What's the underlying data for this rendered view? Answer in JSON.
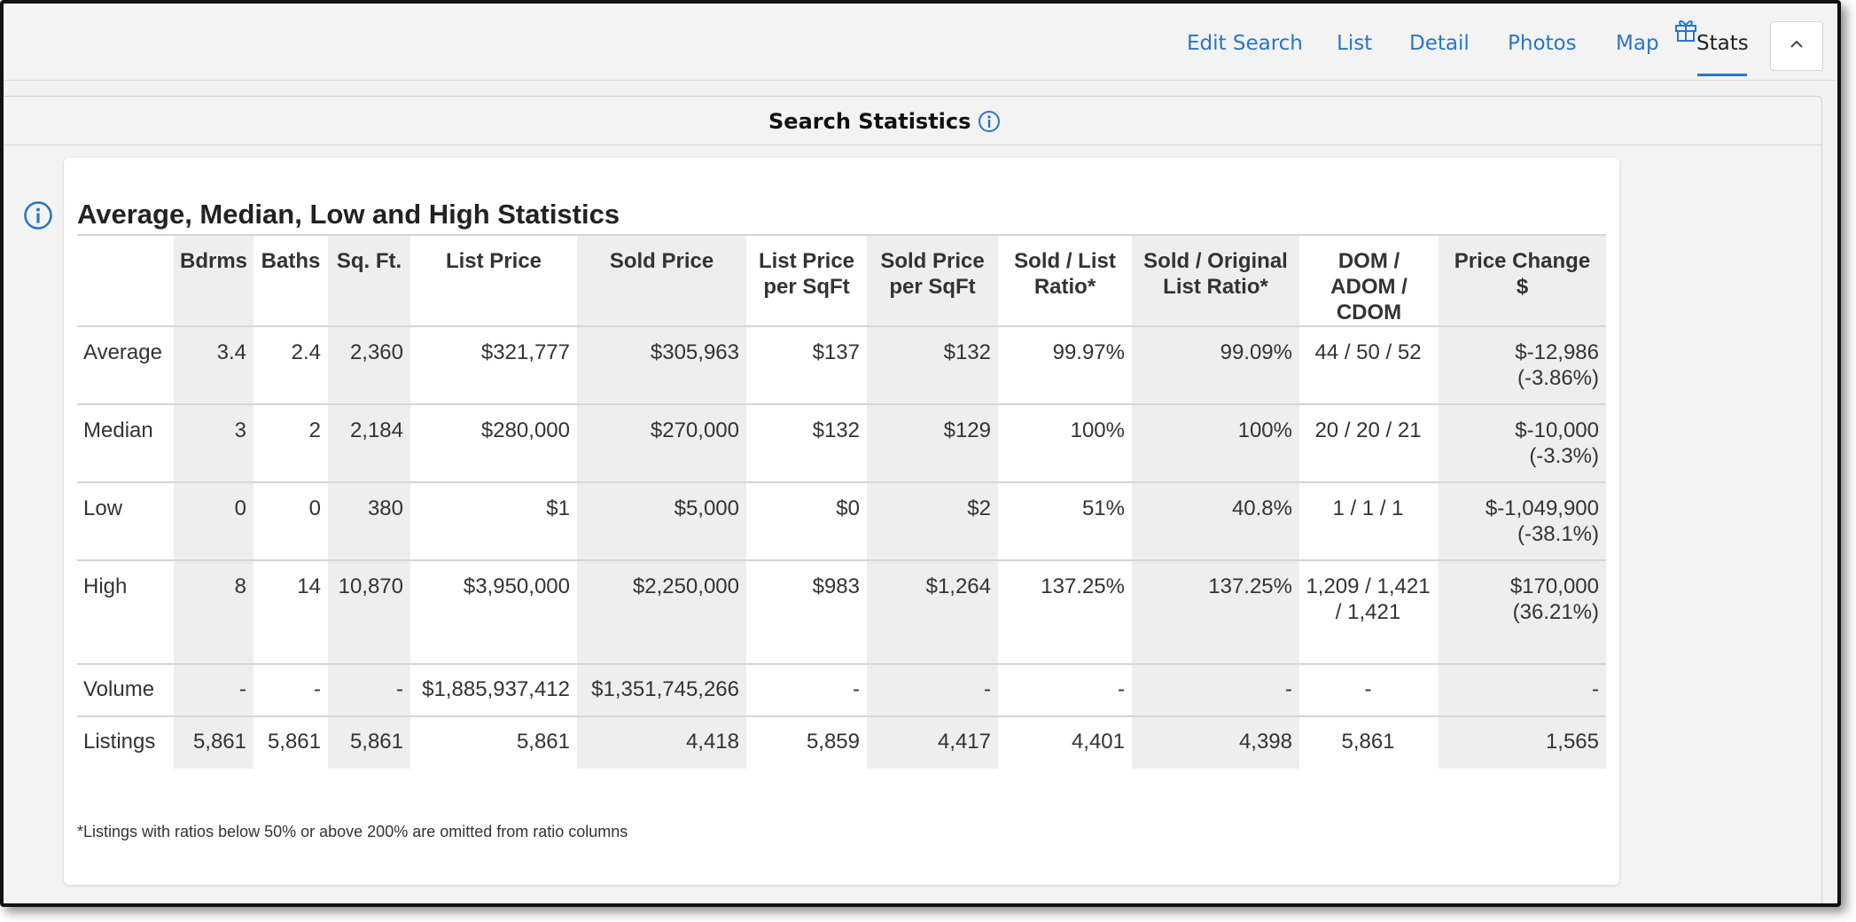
{
  "nav": {
    "edit_search": "Edit Search",
    "list": "List",
    "detail": "Detail",
    "photos": "Photos",
    "map": "Map",
    "stats": "Stats",
    "active": "Stats",
    "gift_icon": "gift-icon",
    "collapse_icon": "chevron-up-icon"
  },
  "panel": {
    "title": "Search Statistics",
    "info_icon": "info-icon"
  },
  "card": {
    "title": "Average, Median, Low and High Statistics",
    "footnote": "*Listings with ratios below 50% or above 200% are omitted from ratio columns"
  },
  "table": {
    "headers": [
      [
        ""
      ],
      [
        "Bdrms"
      ],
      [
        "Baths"
      ],
      [
        "Sq. Ft."
      ],
      [
        "List Price"
      ],
      [
        "Sold Price"
      ],
      [
        "List Price",
        "per SqFt"
      ],
      [
        "Sold Price",
        "per SqFt"
      ],
      [
        "Sold / List",
        "Ratio*"
      ],
      [
        "Sold / Original",
        "List Ratio*"
      ],
      [
        "DOM /",
        "ADOM /",
        "CDOM"
      ],
      [
        "Price Change",
        "$"
      ]
    ],
    "rows": [
      {
        "label": "Average",
        "cells": [
          "3.4",
          "2.4",
          "2,360",
          "$321,777",
          "$305,963",
          "$137",
          "$132",
          "99.97%",
          "99.09%",
          "44 / 50 / 52",
          "$-12,986 (-3.86%)"
        ]
      },
      {
        "label": "Median",
        "cells": [
          "3",
          "2",
          "2,184",
          "$280,000",
          "$270,000",
          "$132",
          "$129",
          "100%",
          "100%",
          "20 / 20 / 21",
          "$-10,000 (-3.3%)"
        ]
      },
      {
        "label": "Low",
        "cells": [
          "0",
          "0",
          "380",
          "$1",
          "$5,000",
          "$0",
          "$2",
          "51%",
          "40.8%",
          "1 / 1 / 1",
          "$-1,049,900 (-38.1%)"
        ]
      },
      {
        "label": "High",
        "cells": [
          "8",
          "14",
          "10,870",
          "$3,950,000",
          "$2,250,000",
          "$983",
          "$1,264",
          "137.25%",
          "137.25%",
          "1,209 / 1,421 / 1,421",
          "$170,000 (36.21%)"
        ]
      },
      {
        "label": "Volume",
        "cells": [
          "-",
          "-",
          "-",
          "$1,885,937,412",
          "$1,351,745,266",
          "-",
          "-",
          "-",
          "-",
          "-",
          "-"
        ]
      },
      {
        "label": "Listings",
        "cells": [
          "5,861",
          "5,861",
          "5,861",
          "5,861",
          "4,418",
          "5,859",
          "4,417",
          "4,401",
          "4,398",
          "5,861",
          "1,565"
        ]
      }
    ]
  },
  "colors": {
    "accent": "#2a75c7",
    "shaded_column": "#eeeeee"
  }
}
